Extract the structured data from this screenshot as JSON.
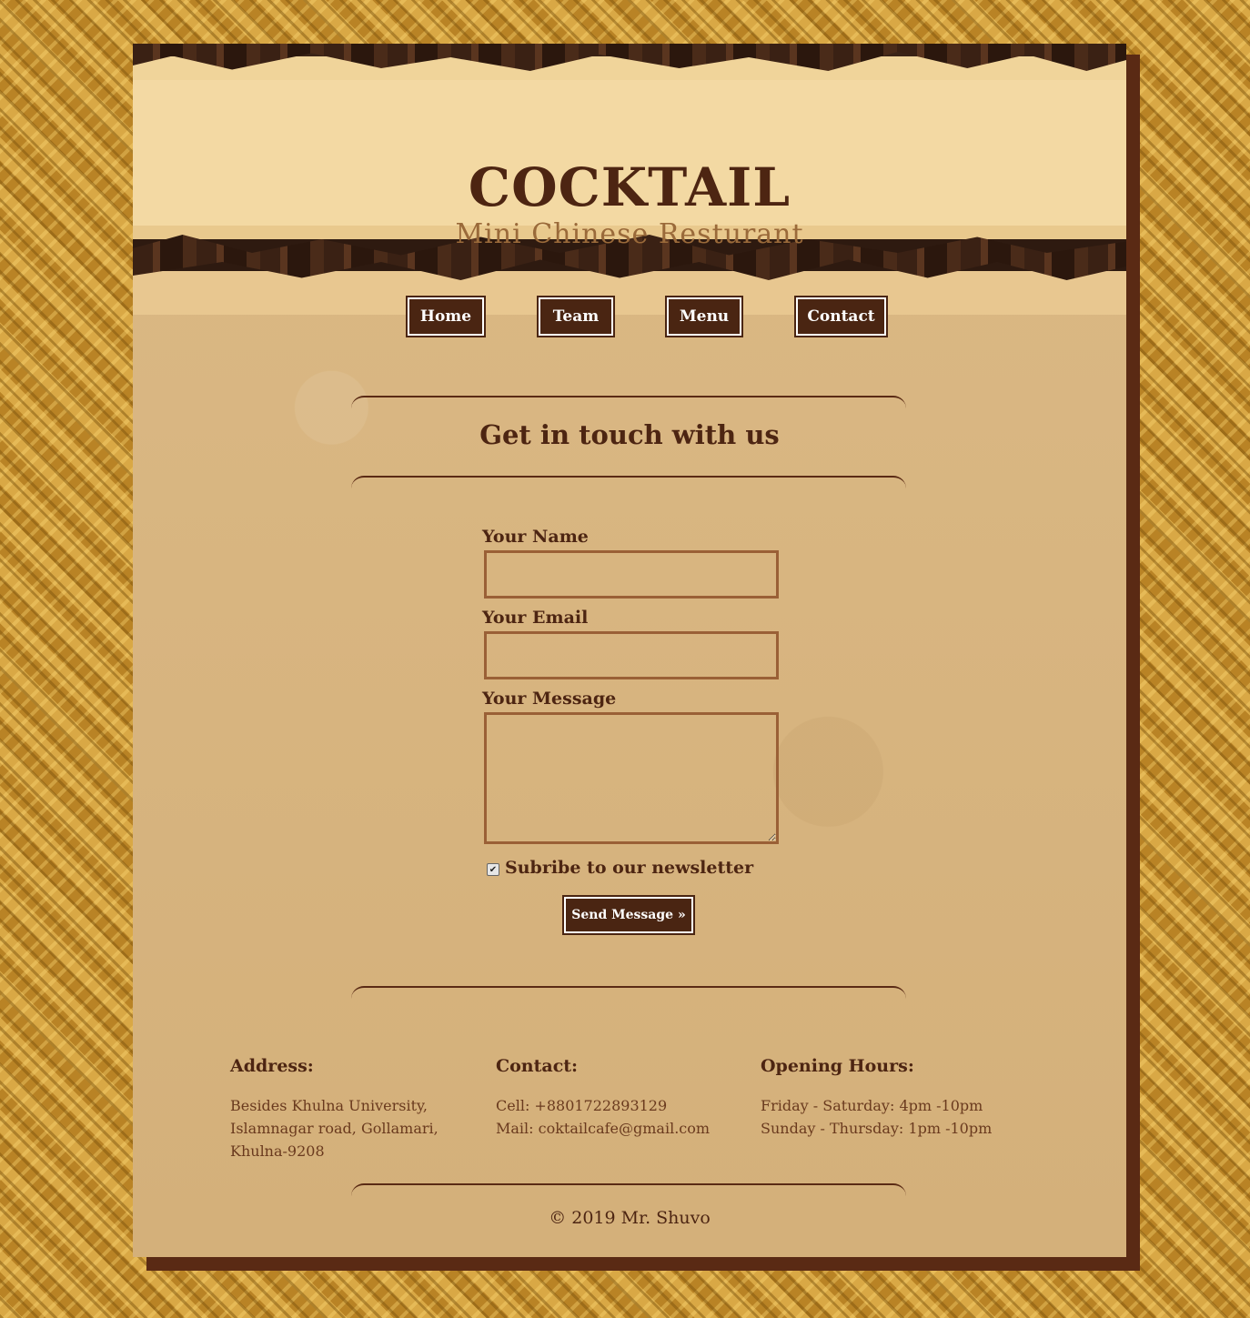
{
  "brand": {
    "title": "COCKTAIL",
    "subtitle": "Mini Chinese Resturant"
  },
  "nav": {
    "items": [
      {
        "label": "Home"
      },
      {
        "label": "Team"
      },
      {
        "label": "Menu"
      },
      {
        "label": "Contact"
      }
    ]
  },
  "contact": {
    "heading": "Get in touch with us",
    "name_label": "Your Name",
    "name_value": "",
    "email_label": "Your Email",
    "email_value": "",
    "message_label": "Your Message",
    "message_value": "",
    "newsletter_label": "Subribe to our newsletter",
    "newsletter_checked": true,
    "send_label": "Send Message »"
  },
  "footer": {
    "address": {
      "heading": "Address:",
      "lines": [
        "Besides Khulna University,",
        "Islamnagar road, Gollamari,",
        "Khulna-9208"
      ]
    },
    "contact": {
      "heading": "Contact:",
      "lines": [
        "Cell: +8801722893129",
        "Mail: coktailcafe@gmail.com"
      ]
    },
    "hours": {
      "heading": "Opening Hours:",
      "lines": [
        "Friday - Saturday: 4pm -10pm",
        "Sunday - Thursday: 1pm -10pm"
      ]
    },
    "copyright": "© 2019 Mr. Shuvo"
  }
}
